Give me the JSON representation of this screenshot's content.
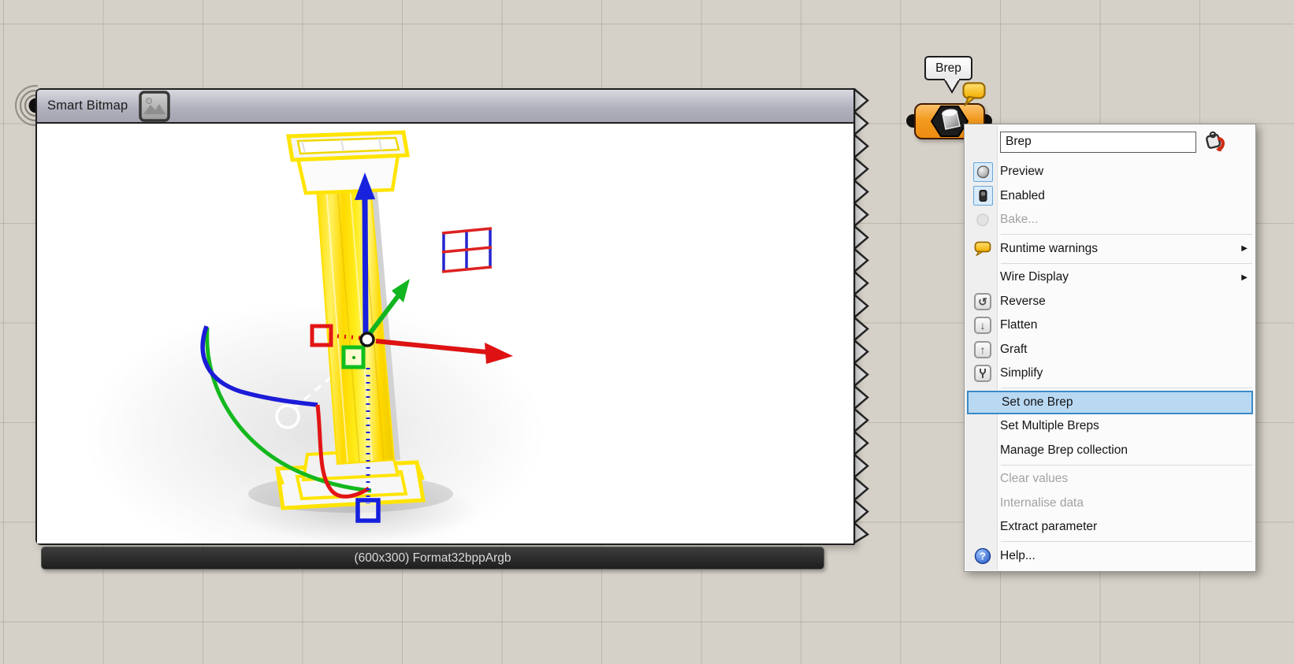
{
  "canvas": {
    "background": "#d5d1c8",
    "grid_line": "#8c877b"
  },
  "smart_bitmap_panel": {
    "title": "Smart Bitmap",
    "caption": "(600x300) Format32bppArgb"
  },
  "brep_component": {
    "tooltip_label": "Brep"
  },
  "context_menu": {
    "name_input": {
      "value": "Brep"
    },
    "items": [
      {
        "label": "Preview",
        "checked": true
      },
      {
        "label": "Enabled",
        "checked": true
      },
      {
        "label": "Bake...",
        "disabled": true
      },
      {
        "label": "Runtime warnings",
        "submenu": true
      },
      {
        "label": "Wire Display",
        "submenu": true
      },
      {
        "label": "Reverse"
      },
      {
        "label": "Flatten"
      },
      {
        "label": "Graft"
      },
      {
        "label": "Simplify"
      },
      {
        "label": "Set one Brep",
        "highlighted": true
      },
      {
        "label": "Set Multiple Breps"
      },
      {
        "label": "Manage Brep collection"
      },
      {
        "label": "Clear values",
        "disabled": true
      },
      {
        "label": "Internalise data",
        "disabled": true
      },
      {
        "label": "Extract parameter"
      },
      {
        "label": "Help..."
      }
    ]
  },
  "glyphs": {
    "submenu": "▶",
    "reverse": "↺",
    "flatten": "↓",
    "graft": "↑",
    "help": "?"
  },
  "colors": {
    "component_orange": "#f29a1f",
    "warning_balloon_yellow": "#ffd24a",
    "menu_highlight": "#b9d9f3",
    "menu_highlight_border": "#3a8ac6",
    "axis_x_red": "#de1212",
    "axis_y_green": "#12b51f",
    "axis_z_blue": "#1822dd",
    "column_yellow": "#ffe400"
  }
}
